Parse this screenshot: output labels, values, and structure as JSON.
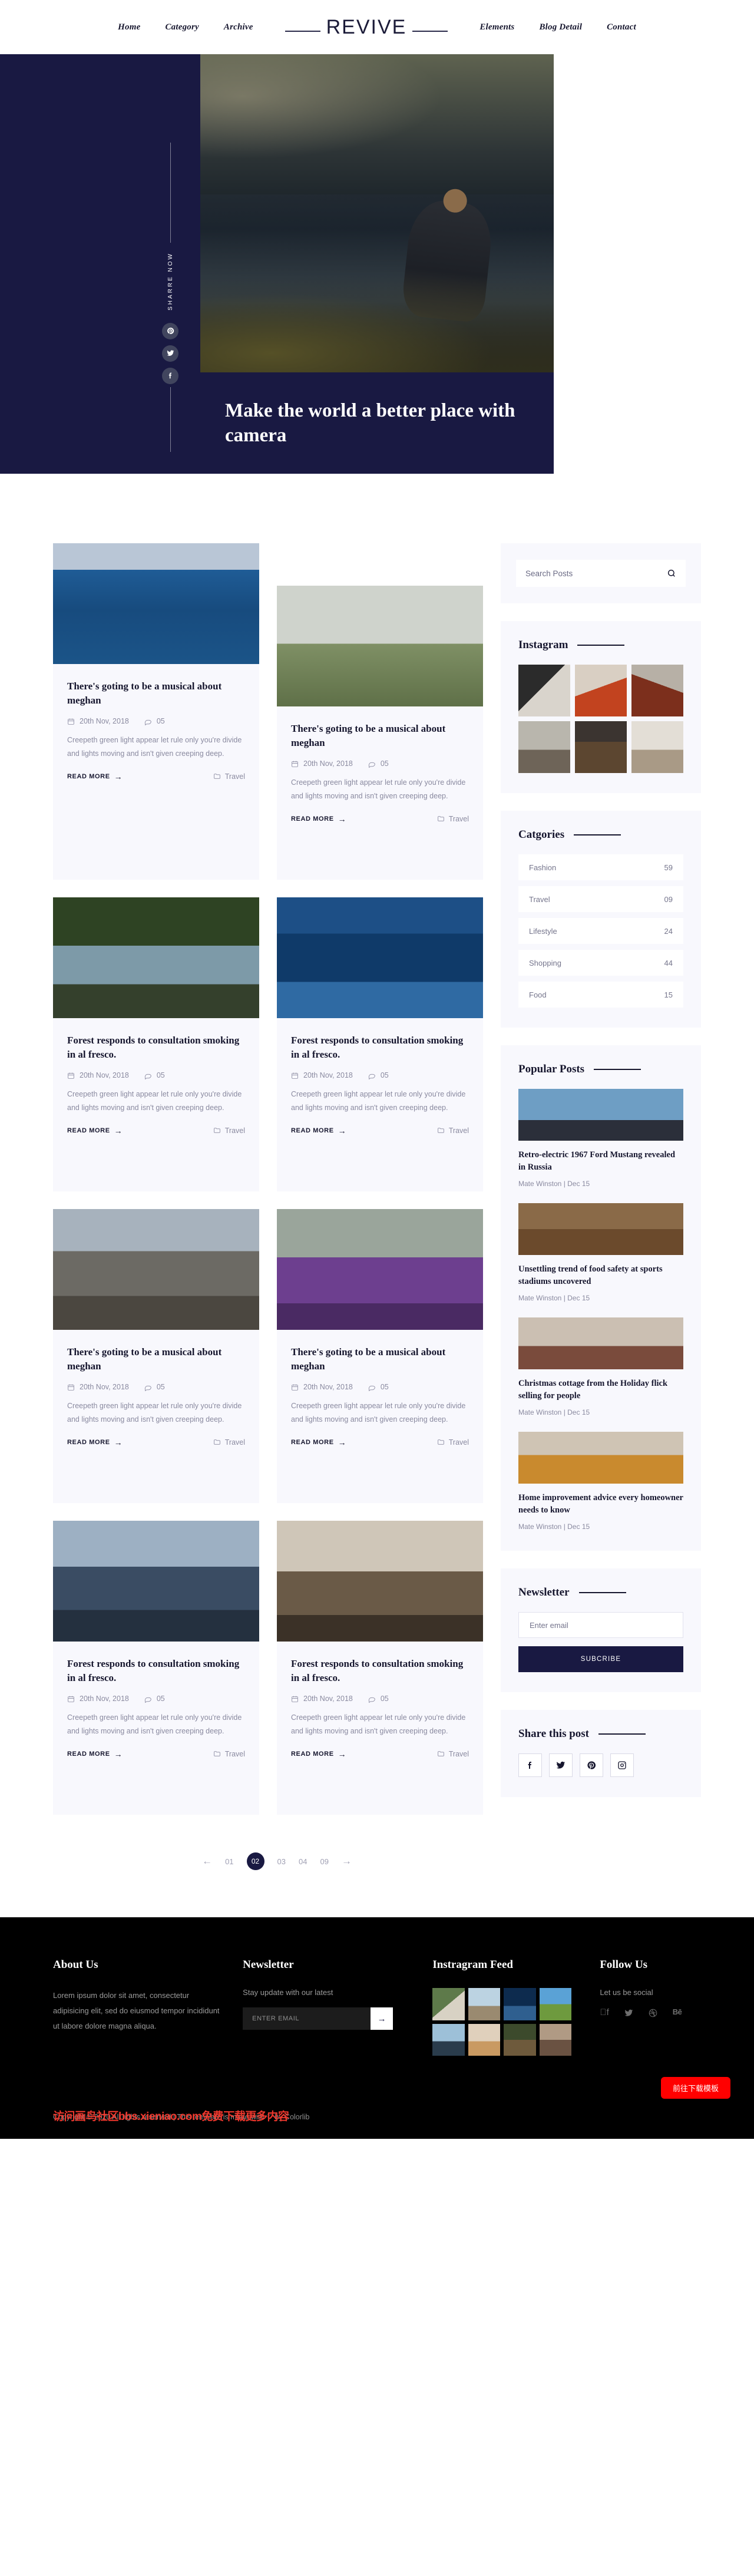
{
  "header": {
    "brand": "REVIVE",
    "nav_left": [
      {
        "label": "Home"
      },
      {
        "label": "Category"
      },
      {
        "label": "Archive"
      }
    ],
    "nav_right": [
      {
        "label": "Elements"
      },
      {
        "label": "Blog Detail"
      },
      {
        "label": "Contact"
      }
    ]
  },
  "hero": {
    "title": "Make the world a better place with camera",
    "share_label": "SHARRE NOW",
    "socials": [
      "pinterest-icon",
      "twitter-icon",
      "facebook-icon"
    ]
  },
  "posts": [
    {
      "title": "There's goting to be a musical about meghan",
      "date": "20th Nov, 2018",
      "comments": "05",
      "excerpt": "Creepeth green light appear let rule only you're divide and lights moving and isn't given creeping deep.",
      "read_more": "READ MORE",
      "category": "Travel",
      "image": "im-whale"
    },
    {
      "title": "There's goting to be a musical about meghan",
      "date": "20th Nov, 2018",
      "comments": "05",
      "excerpt": "Creepeth green light appear let rule only you're divide and lights moving and isn't given creeping deep.",
      "read_more": "READ MORE",
      "category": "Travel",
      "image": "im-snow"
    },
    {
      "title": "Forest responds to consultation smoking in al fresco.",
      "date": "20th Nov, 2018",
      "comments": "05",
      "excerpt": "Creepeth green light appear let rule only you're divide and lights moving and isn't given creeping deep.",
      "read_more": "READ MORE",
      "category": "Travel",
      "image": "im-dome"
    },
    {
      "title": "Forest responds to consultation smoking in al fresco.",
      "date": "20th Nov, 2018",
      "comments": "05",
      "excerpt": "Creepeth green light appear let rule only you're divide and lights moving and isn't given creeping deep.",
      "read_more": "READ MORE",
      "category": "Travel",
      "image": "im-wave"
    },
    {
      "title": "There's goting to be a musical about meghan",
      "date": "20th Nov, 2018",
      "comments": "05",
      "excerpt": "Creepeth green light appear let rule only you're divide and lights moving and isn't given creeping deep.",
      "read_more": "READ MORE",
      "category": "Travel",
      "image": "im-mount"
    },
    {
      "title": "There's goting to be a musical about meghan",
      "date": "20th Nov, 2018",
      "comments": "05",
      "excerpt": "Creepeth green light appear let rule only you're divide and lights moving and isn't given creeping deep.",
      "read_more": "READ MORE",
      "category": "Travel",
      "image": "im-purple"
    },
    {
      "title": "Forest responds to consultation smoking in al fresco.",
      "date": "20th Nov, 2018",
      "comments": "05",
      "excerpt": "Creepeth green light appear let rule only you're divide and lights moving and isn't given creeping deep.",
      "read_more": "READ MORE",
      "category": "Travel",
      "image": "im-city"
    },
    {
      "title": "Forest responds to consultation smoking in al fresco.",
      "date": "20th Nov, 2018",
      "comments": "05",
      "excerpt": "Creepeth green light appear let rule only you're divide and lights moving and isn't given creeping deep.",
      "read_more": "READ MORE",
      "category": "Travel",
      "image": "im-coffee"
    }
  ],
  "sidebar": {
    "search": {
      "placeholder": "Search Posts",
      "value": ""
    },
    "instagram": {
      "title": "Instagram",
      "cells": 6
    },
    "categories": {
      "title": "Catgories",
      "items": [
        {
          "label": "Fashion",
          "count": "59"
        },
        {
          "label": "Travel",
          "count": "09"
        },
        {
          "label": "Lifestyle",
          "count": "24"
        },
        {
          "label": "Shopping",
          "count": "44"
        },
        {
          "label": "Food",
          "count": "15"
        }
      ]
    },
    "popular": {
      "title": "Popular Posts",
      "items": [
        {
          "title": "Retro-electric 1967 Ford Mustang revealed in Russia",
          "meta": "Mate Winston | Dec 15",
          "image": "pp-t1"
        },
        {
          "title": "Unsettling trend of food safety at sports stadiums uncovered",
          "meta": "Mate Winston | Dec 15",
          "image": "pp-t2"
        },
        {
          "title": "Christmas cottage from the Holiday flick selling for people",
          "meta": "Mate Winston | Dec 15",
          "image": "pp-t3"
        },
        {
          "title": "Home improvement advice every homeowner needs to know",
          "meta": "Mate Winston | Dec 15",
          "image": "pp-t4"
        }
      ]
    },
    "newsletter": {
      "title": "Newsletter",
      "placeholder": "Enter email",
      "button": "SUBCRIBE"
    },
    "share": {
      "title": "Share this post",
      "icons": [
        "facebook-icon",
        "twitter-icon",
        "pinterest-icon",
        "instagram-icon"
      ]
    }
  },
  "pagination": {
    "prev": "←",
    "next": "→",
    "pages": [
      "01",
      "02",
      "03",
      "04",
      "09"
    ],
    "active": "02"
  },
  "footer": {
    "about": {
      "title": "About Us",
      "text": "Lorem ipsum dolor sit amet, consectetur adipisicing elit, sed do eiusmod tempor incididunt ut labore dolore magna aliqua."
    },
    "newsletter": {
      "title": "Newsletter",
      "subtitle": "Stay update with our latest",
      "placeholder": "ENTER EMAIL",
      "button": "→"
    },
    "instagram": {
      "title": "Instragram Feed",
      "cells": 8
    },
    "follow": {
      "title": "Follow Us",
      "subtitle": "Let us be social",
      "icons": [
        "facebook-icon",
        "twitter-icon",
        "dribbble-icon",
        "behance-icon"
      ]
    },
    "copyright": "Copyright © 2020 All rights reserved | This template is made with ♡ by Colorlib",
    "watermark": "访问画鸟社区bbs.xieniao.com免费下载更多内容",
    "download_button": "前往下载模板"
  },
  "colors": {
    "navy": "#191942",
    "lavender_bg": "#f8f8fd",
    "muted": "#8a8aa0",
    "red": "#ff0000"
  }
}
